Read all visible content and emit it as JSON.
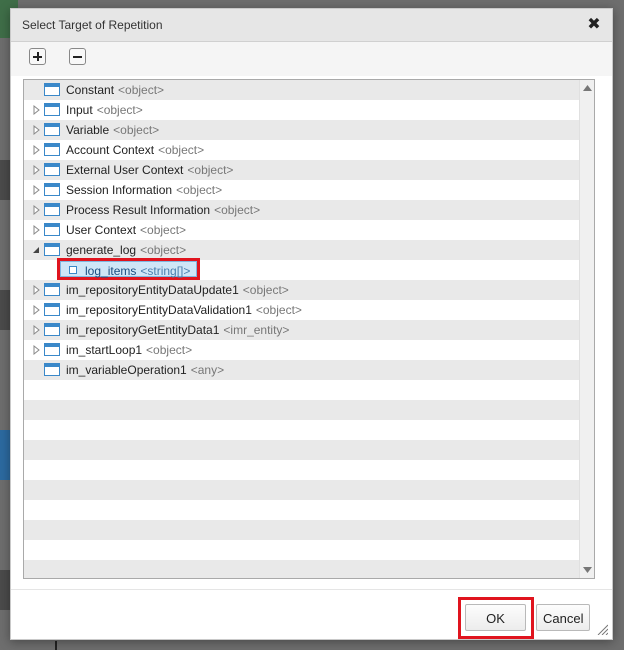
{
  "dialog": {
    "title": "Select Target of Repetition",
    "close_icon": "close-icon",
    "toolbar": {
      "expand_all_icon": "plus-icon",
      "collapse_all_icon": "minus-icon"
    },
    "tree": {
      "items": [
        {
          "name": "Constant",
          "type": "<object>",
          "expander": "none"
        },
        {
          "name": "Input",
          "type": "<object>",
          "expander": "collapsed"
        },
        {
          "name": "Variable",
          "type": "<object>",
          "expander": "collapsed"
        },
        {
          "name": "Account Context",
          "type": "<object>",
          "expander": "collapsed"
        },
        {
          "name": "External User Context",
          "type": "<object>",
          "expander": "collapsed"
        },
        {
          "name": "Session Information",
          "type": "<object>",
          "expander": "collapsed"
        },
        {
          "name": "Process Result Information",
          "type": "<object>",
          "expander": "collapsed"
        },
        {
          "name": "User Context",
          "type": "<object>",
          "expander": "collapsed"
        },
        {
          "name": "generate_log",
          "type": "<object>",
          "expander": "expanded"
        },
        {
          "name": "log_items",
          "type": "<string[]>",
          "expander": "leaf",
          "selected": true
        },
        {
          "name": "im_repositoryEntityDataUpdate1",
          "type": "<object>",
          "expander": "collapsed"
        },
        {
          "name": "im_repositoryEntityDataValidation1",
          "type": "<object>",
          "expander": "collapsed"
        },
        {
          "name": "im_repositoryGetEntityData1",
          "type": "<imr_entity>",
          "expander": "collapsed"
        },
        {
          "name": "im_startLoop1",
          "type": "<object>",
          "expander": "collapsed"
        },
        {
          "name": "im_variableOperation1",
          "type": "<any>",
          "expander": "none"
        }
      ]
    },
    "buttons": {
      "ok_label": "OK",
      "cancel_label": "Cancel"
    },
    "colors": {
      "highlight": "#e0141e",
      "node_icon": "#3a88c9",
      "selected_bg": "#cfe6f7"
    }
  }
}
